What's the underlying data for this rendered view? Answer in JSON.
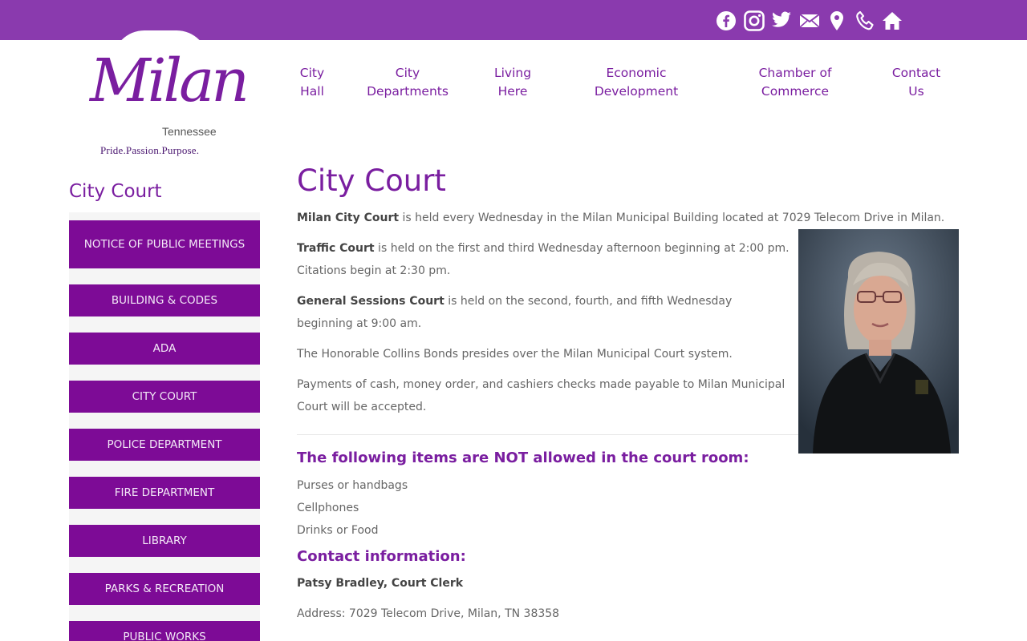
{
  "topbar": {
    "accent": "#8a3aae",
    "icons": [
      "facebook-icon",
      "instagram-icon",
      "twitter-icon",
      "mail-icon",
      "map-pin-icon",
      "phone-icon",
      "home-icon"
    ]
  },
  "logo": {
    "name": "Milan",
    "state": "Tennessee",
    "tagline": "Pride.Passion.Purpose."
  },
  "nav": [
    {
      "line1": "City",
      "line2": "Hall"
    },
    {
      "line1": "City",
      "line2": "Departments"
    },
    {
      "line1": "Living",
      "line2": "Here"
    },
    {
      "line1": "Economic",
      "line2": "Development"
    },
    {
      "line1": "Chamber of",
      "line2": "Commerce"
    },
    {
      "line1": "Contact",
      "line2": "Us"
    }
  ],
  "sidebar": {
    "title": "City Court",
    "items": [
      "Notice of Public Meetings",
      "Building & Codes",
      "ADA",
      "City Court",
      "Police Department",
      "Fire Department",
      "Library",
      "Parks & Recreation",
      "Public Works"
    ]
  },
  "main": {
    "title": "City Court",
    "p1_bold": "Milan City Court",
    "p1_rest": " is held every Wednesday in the Milan Municipal Building located at 7029 Telecom Drive in Milan.",
    "p2_bold": "Traffic Court",
    "p2_rest": " is held on the first and third Wednesday afternoon beginning at 2:00 pm. Citations begin at 2:30 pm.",
    "p3_bold": "General Sessions Court",
    "p3_rest": " is held on the second, fourth, and fifth Wednesday beginning at 9:00 am.",
    "p4": "The Honorable Collins Bonds presides over the Milan Municipal Court system.",
    "p5": "Payments of cash, money order, and cashiers checks made payable to Milan Municipal Court will be accepted.",
    "not_allowed_heading": "The following items are NOT allowed in the court room:",
    "not_allowed": [
      "Purses or handbags",
      "Cellphones",
      "Drinks or Food"
    ],
    "contact_heading": "Contact information:",
    "clerk": "Patsy Bradley, Court Clerk",
    "address": "Address: 7029 Telecom Drive, Milan, TN 38358"
  }
}
